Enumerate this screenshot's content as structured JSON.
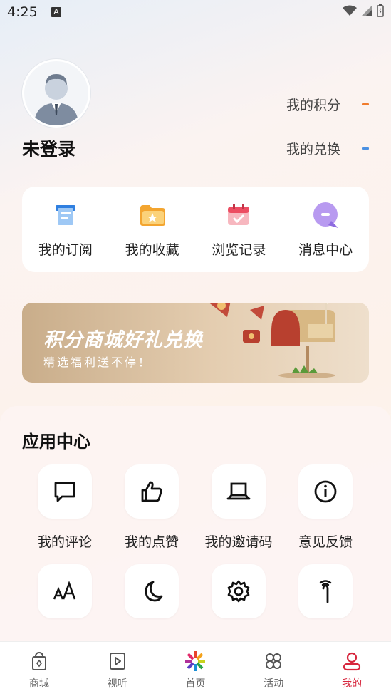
{
  "status_bar": {
    "time": "4:25",
    "notification_glyph": "A"
  },
  "profile": {
    "username": "未登录",
    "points_label": "我的积分",
    "exchange_label": "我的兑换",
    "points_accent": "#f07b2c",
    "exchange_accent": "#4a90e2"
  },
  "quick_actions": [
    {
      "label": "我的订阅",
      "icon": "subscription-icon"
    },
    {
      "label": "我的收藏",
      "icon": "favorites-folder-icon"
    },
    {
      "label": "浏览记录",
      "icon": "history-calendar-icon"
    },
    {
      "label": "消息中心",
      "icon": "message-bubble-icon"
    }
  ],
  "banner": {
    "title": "积分商城好礼兑换",
    "subtitle": "精选福利送不停！"
  },
  "app_center": {
    "title": "应用中心",
    "items": [
      {
        "label": "我的评论",
        "icon": "comment-icon"
      },
      {
        "label": "我的点赞",
        "icon": "thumbs-up-icon"
      },
      {
        "label": "我的邀请码",
        "icon": "laptop-icon"
      },
      {
        "label": "意见反馈",
        "icon": "info-icon"
      },
      {
        "label": "",
        "icon": "font-size-icon"
      },
      {
        "label": "",
        "icon": "moon-icon"
      },
      {
        "label": "",
        "icon": "gear-icon"
      },
      {
        "label": "",
        "icon": "elder-cane-icon"
      }
    ]
  },
  "bottom_nav": {
    "active_color": "#d7263d",
    "items": [
      {
        "label": "商城",
        "icon": "shopping-bag-icon"
      },
      {
        "label": "视听",
        "icon": "video-play-icon"
      },
      {
        "label": "首页",
        "icon": "home-logo-icon"
      },
      {
        "label": "活动",
        "icon": "activity-grid-icon"
      },
      {
        "label": "我的",
        "icon": "profile-icon",
        "active": true
      }
    ]
  }
}
